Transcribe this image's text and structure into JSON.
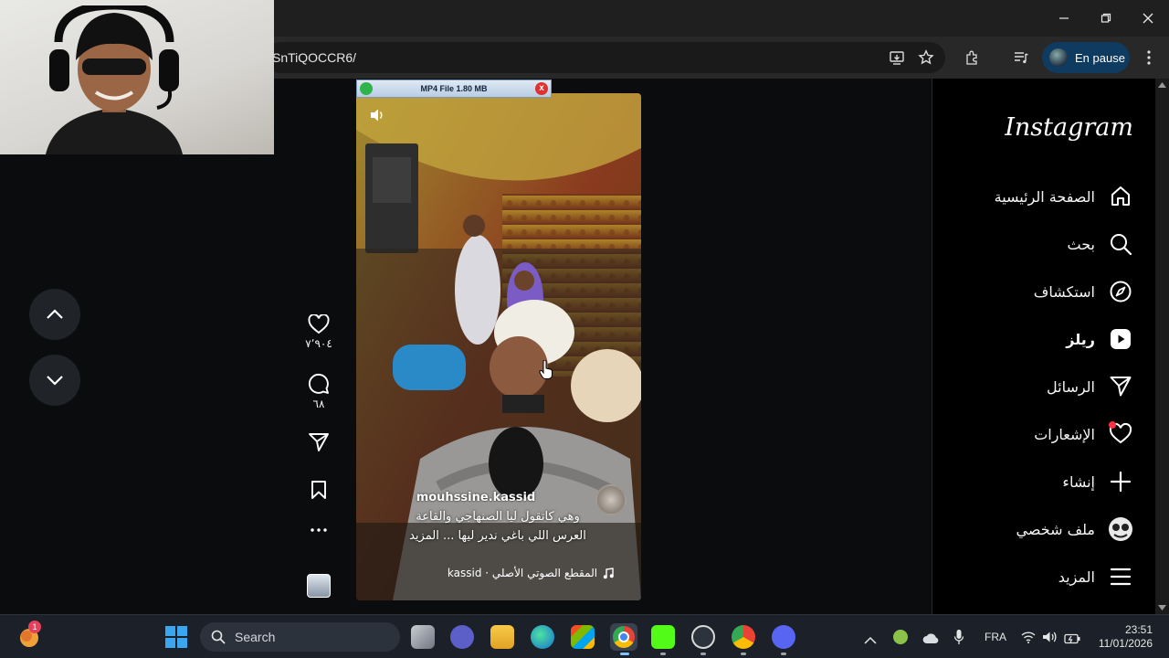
{
  "browser": {
    "url": "SnTiQOCCR6/",
    "profile_label": "En pause",
    "window_controls": [
      "minimize-icon",
      "restore-icon",
      "close-icon"
    ]
  },
  "download_badge": {
    "label": "MP4 File 1.80 MB",
    "close_glyph": "x"
  },
  "reel": {
    "username": "mouhssine.kassid",
    "caption_line1": "وهي كاتقول ليا الصنهاجي والقاعة",
    "caption_line2": "العرس اللي باغي ندير ليها ... المزيد",
    "audio_label": "kassid · المقطع الصوتي الأصلي"
  },
  "actions": {
    "likes": "٧٬٩٠٤",
    "comments": "٦٨"
  },
  "sidebar": {
    "logo": "Instagram",
    "items": [
      {
        "label": "الصفحة الرئيسية",
        "icon": "home-icon"
      },
      {
        "label": "بحث",
        "icon": "search-icon"
      },
      {
        "label": "استكشاف",
        "icon": "compass-icon"
      },
      {
        "label": "ريلز",
        "icon": "reels-icon"
      },
      {
        "label": "الرسائل",
        "icon": "send-icon"
      },
      {
        "label": "الإشعارات",
        "icon": "heart-icon"
      },
      {
        "label": "إنشاء",
        "icon": "plus-icon"
      },
      {
        "label": "ملف شخصي",
        "icon": "profile-avatar-icon"
      },
      {
        "label": "المزيد",
        "icon": "menu-icon"
      }
    ]
  },
  "taskbar": {
    "search_label": "Search",
    "language": "FRA",
    "time": "23:51",
    "date": "11/01/2026",
    "notification_badge": "1"
  },
  "colors": {
    "accent_blue": "#0e3b5f",
    "notification_red": "#ff3040",
    "page_bg": "#0b0c0e"
  }
}
